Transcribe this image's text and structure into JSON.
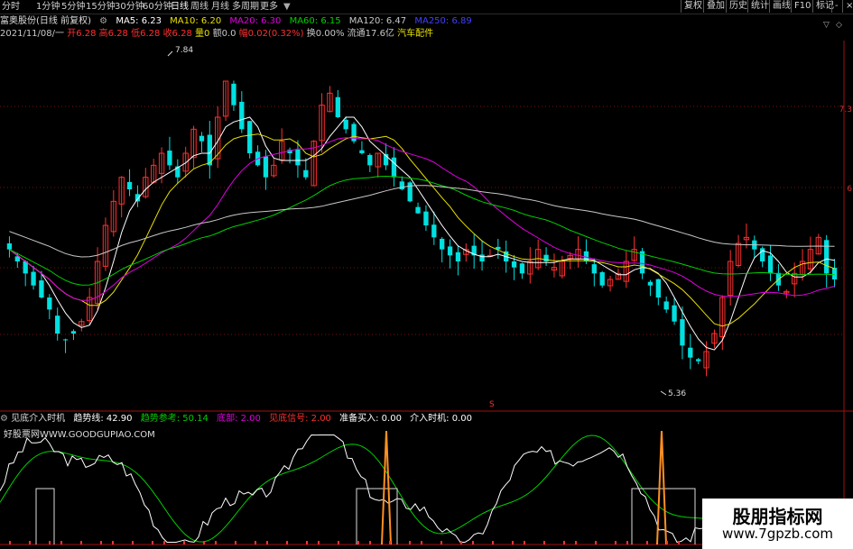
{
  "toolbar": {
    "timeframes": [
      "分时",
      "1分钟",
      "5分钟",
      "15分钟",
      "30分钟",
      "60分钟",
      "日线",
      "周线",
      "月线",
      "多周期",
      "更多"
    ],
    "active_timeframe": "日线",
    "buttons": [
      "复权",
      "叠加",
      "历史",
      "统计",
      "画线",
      "F10",
      "标记",
      "-"
    ],
    "close_label": "×"
  },
  "main": {
    "stock_title": "富奥股份(日线 前复权)",
    "ma": [
      {
        "label": "MA5: 6.23",
        "color": "#ffffff"
      },
      {
        "label": "MA10: 6.20",
        "color": "#e8e000"
      },
      {
        "label": "MA20: 6.30",
        "color": "#e000e0"
      },
      {
        "label": "MA60: 6.15",
        "color": "#00d000"
      },
      {
        "label": "MA120: 6.47",
        "color": "#c8c8c8"
      },
      {
        "label": "MA250: 6.89",
        "color": "#4040ff"
      }
    ],
    "info": [
      {
        "label": "2021/11/08/一",
        "color": "#c8c8c8"
      },
      {
        "label": "开6.28",
        "color": "#ff3030"
      },
      {
        "label": "高6.28",
        "color": "#ff3030"
      },
      {
        "label": "低6.28",
        "color": "#ff3030"
      },
      {
        "label": "收6.28",
        "color": "#ff3030"
      },
      {
        "label": "量0",
        "color": "#e8e000"
      },
      {
        "label": "额0.0",
        "color": "#c8c8c8"
      },
      {
        "label": "幅0.02(0.32%)",
        "color": "#ff3030"
      },
      {
        "label": "换0.00%",
        "color": "#c8c8c8"
      },
      {
        "label": "流通17.6亿",
        "color": "#c8c8c8"
      },
      {
        "label": "汽车配件",
        "color": "#e8e000"
      }
    ],
    "high_label": "7.84",
    "low_label": "5.36",
    "marker_s": "S",
    "right_axis": [
      "7.3",
      "6"
    ]
  },
  "indicator": {
    "name": "见底介入时机",
    "values": [
      {
        "label": "趋势线: 42.90",
        "color": "#ffffff"
      },
      {
        "label": "趋势参考: 50.14",
        "color": "#00d000"
      },
      {
        "label": "底部: 2.00",
        "color": "#e000e0"
      },
      {
        "label": "见底信号: 2.00",
        "color": "#ff3030"
      },
      {
        "label": "准备买入: 0.00",
        "color": "#ffffff"
      },
      {
        "label": "介入时机: 0.00",
        "color": "#ffffff"
      }
    ],
    "watermark": "好股票网WWW.GOODGUPIAO.COM"
  },
  "brand": {
    "title": "股朋指标网",
    "url": "www.7gpzb.com"
  },
  "colors": {
    "up": "#ff3030",
    "down": "#00e0e0",
    "ma5": "#ffffff",
    "ma10": "#e8e000",
    "ma20": "#e000e0",
    "ma60": "#00d000",
    "ma120": "#c8c8c8",
    "spike": "#ff9020"
  },
  "chart_data": {
    "type": "candlestick",
    "y_range": [
      5.0,
      8.0
    ],
    "close_series": [
      6.3,
      6.2,
      6.1,
      6.0,
      5.9,
      5.8,
      5.6,
      5.55,
      5.6,
      5.7,
      5.9,
      6.2,
      6.5,
      6.7,
      6.9,
      6.8,
      6.7,
      6.9,
      7.0,
      7.1,
      7.0,
      6.9,
      7.1,
      7.3,
      7.2,
      7.0,
      7.4,
      7.7,
      7.5,
      7.3,
      7.1,
      7.0,
      6.9,
      7.0,
      7.2,
      7.1,
      7.0,
      6.9,
      7.2,
      7.5,
      7.6,
      7.4,
      7.3,
      7.2,
      7.1,
      7.0,
      7.1,
      7.0,
      6.9,
      6.8,
      6.7,
      6.6,
      6.5,
      6.4,
      6.3,
      6.25,
      6.2,
      6.3,
      6.25,
      6.2,
      6.25,
      6.3,
      6.2,
      6.15,
      6.1,
      6.2,
      6.3,
      6.2,
      6.15,
      6.2,
      6.25,
      6.3,
      6.2,
      6.1,
      6.0,
      6.05,
      6.1,
      6.2,
      6.3,
      6.1,
      6.0,
      5.9,
      5.8,
      5.7,
      5.5,
      5.4,
      5.37,
      5.45,
      5.6,
      5.9,
      6.2,
      6.35,
      6.4,
      6.3,
      6.2,
      6.1,
      6.0,
      5.95,
      6.1,
      6.2,
      6.3,
      6.4,
      6.1,
      6.05
    ]
  }
}
